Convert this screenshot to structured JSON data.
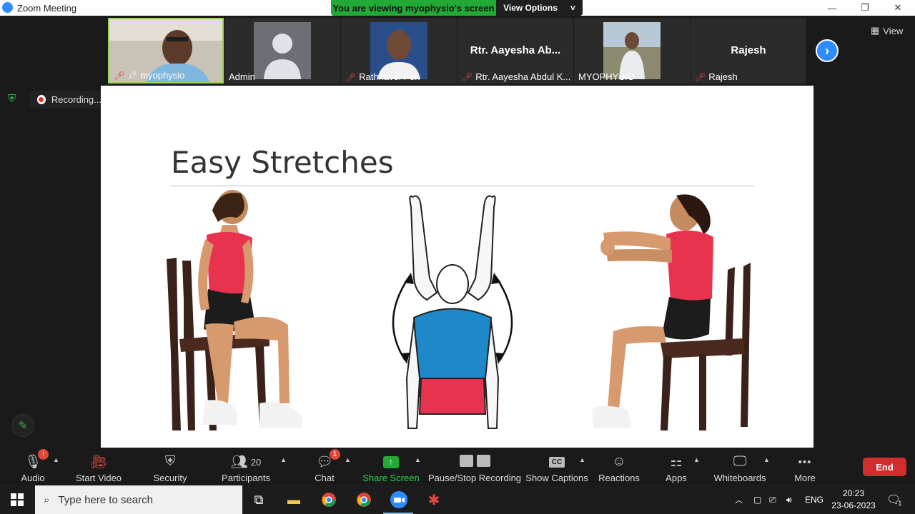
{
  "window": {
    "title": "Zoom Meeting",
    "controls": {
      "minimize": "—",
      "maximize": "❐",
      "close": "✕"
    }
  },
  "banner": {
    "viewing_text": "You are viewing myophysio's screen",
    "view_options_label": "View Options",
    "view_options_caret": "˅"
  },
  "participants": [
    {
      "name": "myophysio",
      "muted": true,
      "pinned": true,
      "type": "video",
      "active": true
    },
    {
      "name": "Admin",
      "muted": false,
      "type": "avatar"
    },
    {
      "name": "Rathnavel Pon",
      "muted": true,
      "type": "photo"
    },
    {
      "display": "Rtr. Aayesha Ab...",
      "name": "Rtr. Aayesha Abdul K...",
      "muted": true,
      "type": "name"
    },
    {
      "name": "MYOPHYSIO",
      "muted": false,
      "type": "photo"
    },
    {
      "display": "Rajesh",
      "name": "Rajesh",
      "muted": true,
      "type": "name"
    }
  ],
  "gallery": {
    "view_label": "View",
    "next_icon": "›"
  },
  "recording": {
    "label": "Recording...",
    "pause_icon": "❚❚",
    "stop_icon": "■"
  },
  "slide": {
    "title": "Easy Stretches"
  },
  "toolbar": {
    "items": [
      {
        "label": "Audio",
        "icon": "microphone-icon",
        "badge": "!"
      },
      {
        "label": "Start Video",
        "icon": "video-off-icon"
      },
      {
        "label": "Security",
        "icon": "shield-icon"
      },
      {
        "label": "Participants",
        "icon": "participants-icon",
        "count": "20"
      },
      {
        "label": "Chat",
        "icon": "chat-icon",
        "badge": "1"
      },
      {
        "label": "Share Screen",
        "icon": "share-screen-icon"
      },
      {
        "label": "Pause/Stop Recording",
        "icon": "recording-controls-icon"
      },
      {
        "label": "Show Captions",
        "icon": "captions-icon",
        "icon_text": "CC"
      },
      {
        "label": "Reactions",
        "icon": "reactions-icon"
      },
      {
        "label": "Apps",
        "icon": "apps-icon"
      },
      {
        "label": "Whiteboards",
        "icon": "whiteboard-icon"
      },
      {
        "label": "More",
        "icon": "more-icon",
        "icon_text": "•••"
      }
    ],
    "end_label": "End"
  },
  "taskbar": {
    "search_placeholder": "Type here to search",
    "language": "ENG",
    "time": "20:23",
    "date": "23-06-2023",
    "notification_count": "1"
  },
  "colors": {
    "share_green": "#23a936",
    "zoom_blue": "#2d8cff",
    "end_red": "#d32c2c",
    "shirt_red": "#e8334f",
    "shirt_blue": "#1e88c8"
  }
}
